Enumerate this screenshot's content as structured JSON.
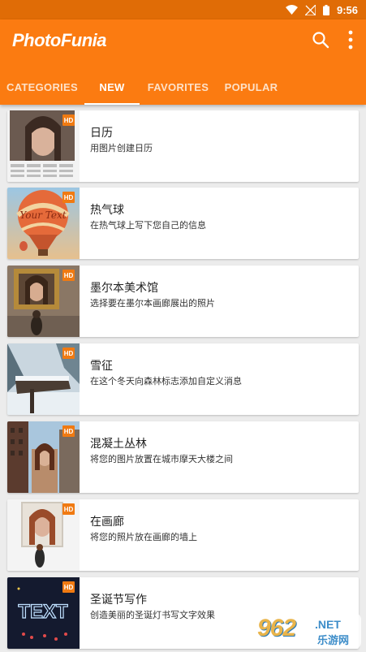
{
  "status_bar": {
    "time": "9:56"
  },
  "app": {
    "logo_part1": "Photo",
    "logo_part2": "Funia",
    "brand_color": "#fb7b11"
  },
  "tabs": [
    {
      "label": "CATEGORIES",
      "active": false
    },
    {
      "label": "NEW",
      "active": true
    },
    {
      "label": "FAVORITES",
      "active": false
    },
    {
      "label": "POPULAR",
      "active": false
    }
  ],
  "items": [
    {
      "title": "日历",
      "description": "用图片创建日历",
      "badge": "HD"
    },
    {
      "title": "热气球",
      "description": "在热气球上写下您自己的信息",
      "badge": "HD"
    },
    {
      "title": "墨尔本美术馆",
      "description": "选择要在墨尔本画廊展出的照片",
      "badge": "HD"
    },
    {
      "title": "雪征",
      "description": "在这个冬天向森林标志添加自定义消息",
      "badge": "HD"
    },
    {
      "title": "混凝土丛林",
      "description": "将您的图片放置在城市摩天大楼之间",
      "badge": "HD"
    },
    {
      "title": "在画廊",
      "description": "将您的照片放在画廊的墙上",
      "badge": "HD"
    },
    {
      "title": "圣诞节写作",
      "description": "创造美丽的圣诞灯书写文字效果",
      "badge": "HD"
    }
  ],
  "thumb_texts": {
    "balloon": "Your Text",
    "xmas": "TEXT"
  },
  "watermark": {
    "number": "962",
    "net": ".NET",
    "sub": "乐游网"
  }
}
